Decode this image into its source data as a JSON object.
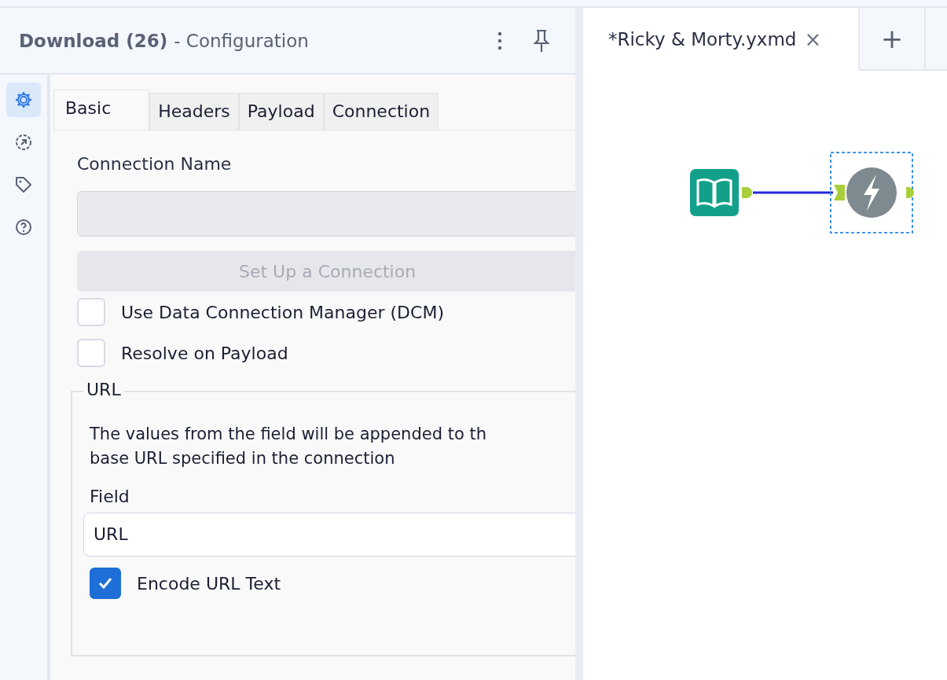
{
  "panel": {
    "title": "Download (26)",
    "subtitle": "- Configuration"
  },
  "rail": [
    {
      "kind": "gear",
      "selected": true
    },
    {
      "kind": "arrow",
      "selected": false
    },
    {
      "kind": "tag",
      "selected": false
    },
    {
      "kind": "help",
      "selected": false
    }
  ],
  "tabs": [
    {
      "label": "Basic",
      "selected": true
    },
    {
      "label": "Headers",
      "selected": false
    },
    {
      "label": "Payload",
      "selected": false
    },
    {
      "label": "Connection",
      "selected": false
    }
  ],
  "connection_name": {
    "label": "Connection Name",
    "disabled": true
  },
  "setup_button": {
    "label": "Set Up a Connection",
    "disabled": true
  },
  "options": [
    {
      "label": "Use Data Connection Manager (DCM)",
      "checked": false
    },
    {
      "label": "Resolve on Payload",
      "checked": false
    }
  ],
  "url_group": {
    "legend": "URL",
    "description_lines": [
      "The values from the field will be appended to th",
      "base URL specified in the connection"
    ],
    "field_label": "Field",
    "field_value": "URL",
    "encode": {
      "label": "Encode URL Text",
      "checked": true
    }
  },
  "document_tabs": [
    {
      "label": "*Ricky & Morty.yxmd",
      "close": "×",
      "selected": true
    }
  ],
  "new_tab": "+",
  "canvas": {
    "nodes": [
      {
        "kind": "input",
        "selected": false
      },
      {
        "kind": "download",
        "selected": true
      }
    ]
  }
}
